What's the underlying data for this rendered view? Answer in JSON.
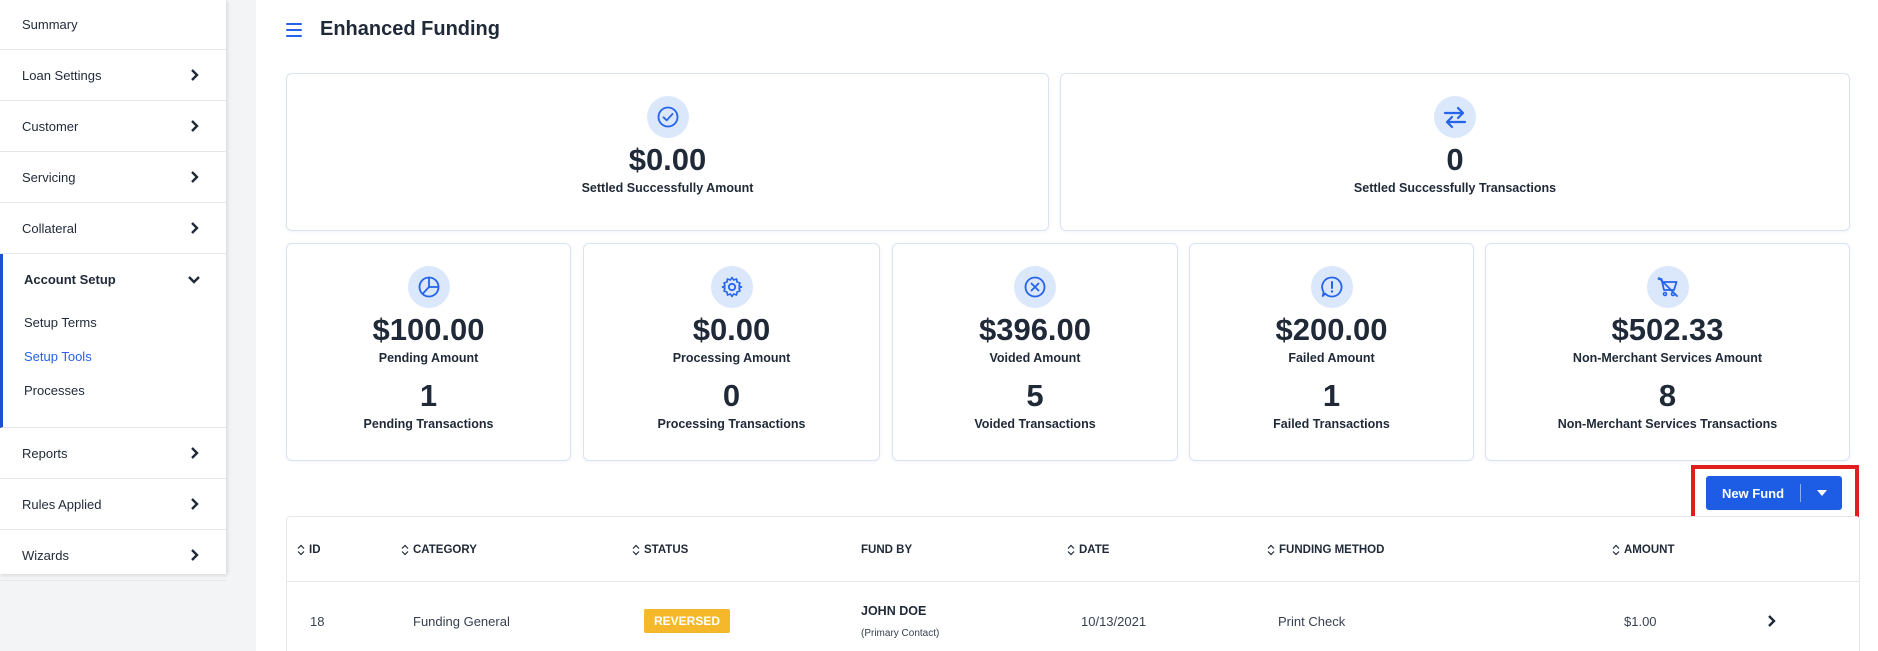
{
  "sidebar": {
    "items_top": [
      {
        "label": "Summary"
      },
      {
        "label": "Loan Settings"
      },
      {
        "label": "Customer"
      },
      {
        "label": "Servicing"
      },
      {
        "label": "Collateral"
      }
    ],
    "group": {
      "label": "Account Setup",
      "children": [
        {
          "label": "Setup Terms"
        },
        {
          "label": "Setup Tools"
        },
        {
          "label": "Processes"
        }
      ]
    },
    "items_bottom": [
      {
        "label": "Reports"
      },
      {
        "label": "Rules Applied"
      },
      {
        "label": "Wizards"
      }
    ]
  },
  "header": {
    "title": "Enhanced Funding"
  },
  "summary": {
    "settled_amount": {
      "value": "$0.00",
      "label": "Settled Successfully Amount",
      "icon": "check-circle-icon"
    },
    "settled_transactions": {
      "value": "0",
      "label": "Settled Successfully Transactions",
      "icon": "swap-arrows-icon"
    }
  },
  "stats": [
    {
      "amount": "$100.00",
      "amount_label": "Pending Amount",
      "count": "1",
      "count_label": "Pending Transactions",
      "icon": "pie-chart-icon"
    },
    {
      "amount": "$0.00",
      "amount_label": "Processing Amount",
      "count": "0",
      "count_label": "Processing Transactions",
      "icon": "gear-icon"
    },
    {
      "amount": "$396.00",
      "amount_label": "Voided Amount",
      "count": "5",
      "count_label": "Voided Transactions",
      "icon": "x-circle-icon"
    },
    {
      "amount": "$200.00",
      "amount_label": "Failed Amount",
      "count": "1",
      "count_label": "Failed Transactions",
      "icon": "alert-bubble-icon"
    },
    {
      "amount": "$502.33",
      "amount_label": "Non-Merchant Services Amount",
      "count": "8",
      "count_label": "Non-Merchant Services Transactions",
      "icon": "cart-off-icon"
    }
  ],
  "new_fund_button": {
    "label": "New Fund"
  },
  "table": {
    "columns": [
      "ID",
      "CATEGORY",
      "STATUS",
      "FUND BY",
      "DATE",
      "FUNDING METHOD",
      "AMOUNT"
    ],
    "rows": [
      {
        "id": "18",
        "category": "Funding General",
        "status": "REVERSED",
        "fund_by_name": "JOHN DOE",
        "fund_by_role": "(Primary Contact)",
        "date": "10/13/2021",
        "method": "Print Check",
        "amount": "$1.00"
      }
    ]
  },
  "colors": {
    "accent": "#1d5de6",
    "status_reversed": "#f6b82b",
    "highlight": "#e11d1d"
  }
}
